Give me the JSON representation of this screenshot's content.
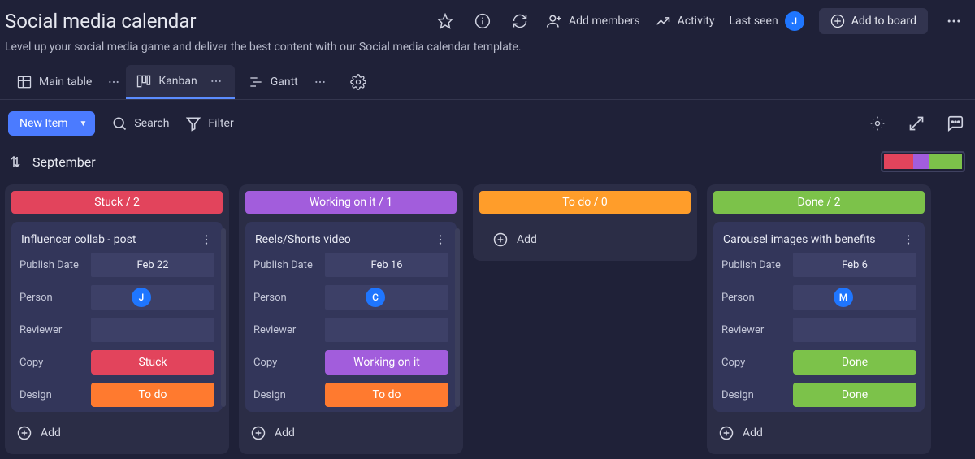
{
  "header": {
    "title": "Social media calendar",
    "subtitle": "Level up your social media game and deliver the best content with our Social media calendar template.",
    "add_members": "Add members",
    "activity": "Activity",
    "last_seen": "Last seen",
    "last_seen_avatar": "J",
    "add_to_board": "Add to board"
  },
  "tabs": {
    "main_table": "Main table",
    "kanban": "Kanban",
    "gantt": "Gantt"
  },
  "toolbar": {
    "new_item": "New Item",
    "search": "Search",
    "filter": "Filter"
  },
  "month": "September",
  "legend_colors": [
    "#e2445c",
    "#a25ddc",
    "#7cc24a"
  ],
  "columns": [
    {
      "title": "Stuck / 2",
      "color": "#e2445c",
      "cards": [
        {
          "title": "Influencer collab - post",
          "publishLabel": "Publish Date",
          "publishDate": "Feb 22",
          "personLabel": "Person",
          "personInitial": "J",
          "reviewerLabel": "Reviewer",
          "copyLabel": "Copy",
          "copyStatus": "Stuck",
          "copyColor": "#e2445c",
          "designLabel": "Design",
          "designStatus": "To do",
          "designColor": "#ff7a2f"
        }
      ],
      "addLabel": "Add",
      "showScrollbar": true
    },
    {
      "title": "Working on it / 1",
      "color": "#a25ddc",
      "cards": [
        {
          "title": "Reels/Shorts video",
          "publishLabel": "Publish Date",
          "publishDate": "Feb 16",
          "personLabel": "Person",
          "personInitial": "C",
          "reviewerLabel": "Reviewer",
          "copyLabel": "Copy",
          "copyStatus": "Working on it",
          "copyColor": "#a25ddc",
          "designLabel": "Design",
          "designStatus": "To do",
          "designColor": "#ff7a2f"
        }
      ],
      "addLabel": "Add",
      "showScrollbar": true
    },
    {
      "title": "To do / 0",
      "color": "#ff9d2a",
      "cards": [],
      "addLabel": "Add",
      "showScrollbar": false
    },
    {
      "title": "Done / 2",
      "color": "#7cc24a",
      "cards": [
        {
          "title": "Carousel images with benefits",
          "publishLabel": "Publish Date",
          "publishDate": "Feb 6",
          "personLabel": "Person",
          "personInitial": "M",
          "reviewerLabel": "Reviewer",
          "copyLabel": "Copy",
          "copyStatus": "Done",
          "copyColor": "#7cc24a",
          "designLabel": "Design",
          "designStatus": "Done",
          "designColor": "#7cc24a"
        }
      ],
      "addLabel": "Add",
      "showScrollbar": false
    }
  ]
}
